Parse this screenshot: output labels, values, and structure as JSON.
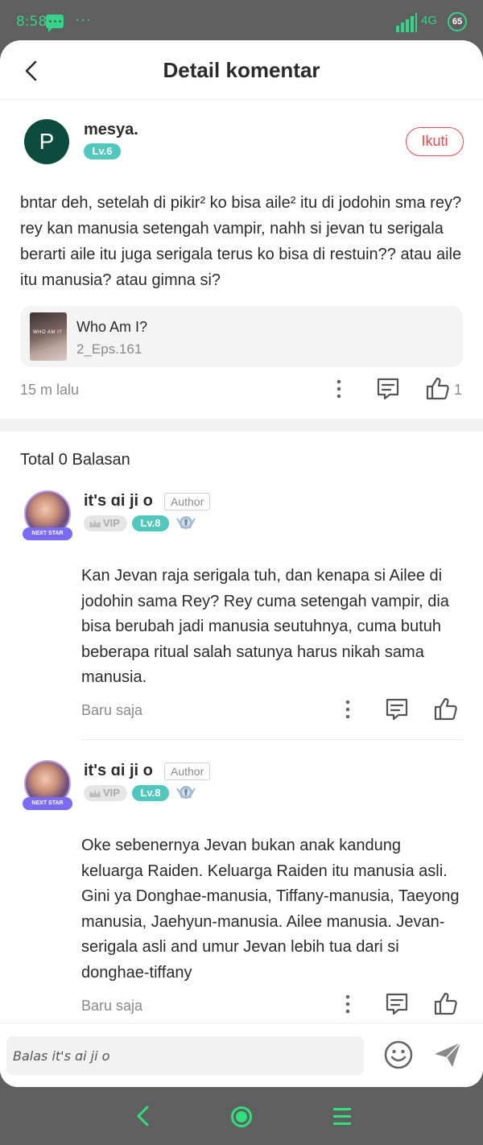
{
  "status_bar": {
    "time": "8:58",
    "network": "4G",
    "battery": "65",
    "accent_color": "#36d38a",
    "icons": [
      "message-icon",
      "more-dots-icon",
      "signal-icon",
      "battery-icon"
    ]
  },
  "header": {
    "title": "Detail komentar"
  },
  "comment": {
    "author": "mesya.",
    "avatar_letter": "P",
    "level": "Lv.6",
    "follow_label": "Ikuti",
    "text": "bntar deh, setelah di pikir² ko bisa aile² itu di jodohin sma rey? rey kan manusia setengah vampir, nahh si jevan tu serigala berarti aile itu juga serigala terus ko bisa di restuin?? atau aile itu manusia? atau gimna si?",
    "book": {
      "cover_text": "WHO AM I?",
      "title": "Who Am I?",
      "episode": "2_Eps.161"
    },
    "time": "15 m lalu",
    "like_count": "1"
  },
  "replies_header": "Total 0 Balasan",
  "replies": [
    {
      "author": "it's ɑi ji o",
      "tag": "Author",
      "vip": "VIP",
      "level": "Lv.8",
      "avatar_frame_text": "NEXT STAR",
      "text": "Kan Jevan raja serigala tuh, dan kenapa si Ailee di jodohin sama Rey? Rey cuma setengah vampir, dia bisa berubah jadi manusia seutuhnya, cuma butuh beberapa ritual salah satunya harus nikah sama manusia.",
      "time": "Baru saja"
    },
    {
      "author": "it's ɑi ji o",
      "tag": "Author",
      "vip": "VIP",
      "level": "Lv.8",
      "avatar_frame_text": "NEXT STAR",
      "text": "Oke sebenernya Jevan bukan anak kandung keluarga Raiden. Keluarga Raiden itu manusia asli. Gini ya Donghae-manusia, Tiffany-manusia, Taeyong manusia, Jaehyun-manusia. Ailee manusia. Jevan-serigala asli and umur Jevan lebih tua dari si donghae-tiffany",
      "time": "Baru saja"
    }
  ],
  "reply_input": {
    "placeholder": "Balas it's ɑi ji o"
  },
  "colors": {
    "follow": "#f0474f",
    "level_badge": "#52c7be",
    "nav_accent": "#2fe07c"
  }
}
